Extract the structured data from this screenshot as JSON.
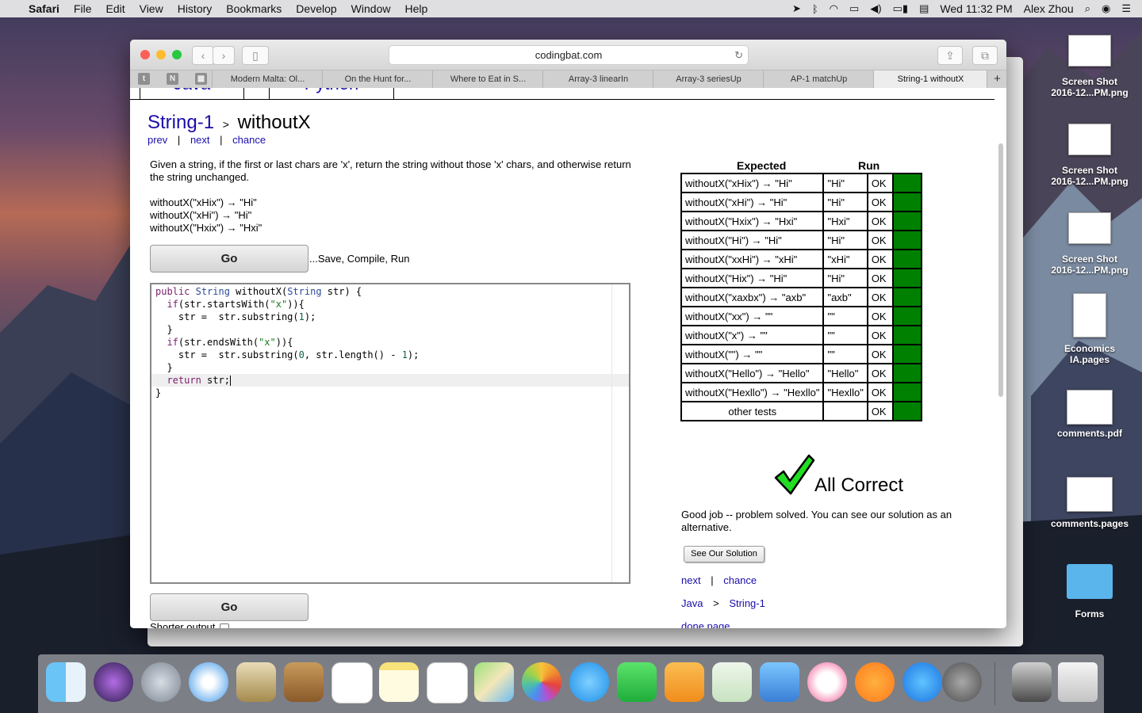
{
  "menubar": {
    "apple": "",
    "app": "Safari",
    "menus": [
      "File",
      "Edit",
      "View",
      "History",
      "Bookmarks",
      "Develop",
      "Window",
      "Help"
    ],
    "clock": "Wed 11:32 PM",
    "user": "Alex Zhou"
  },
  "desktop": {
    "icons": [
      {
        "label1": "Screen Shot",
        "label2": "2016-12...PM.png"
      },
      {
        "label1": "Screen Shot",
        "label2": "2016-12...PM.png"
      },
      {
        "label1": "Screen Shot",
        "label2": "2016-12...PM.png"
      },
      {
        "label1": "Economics",
        "label2": "IA.pages"
      },
      {
        "label1": "comments.pdf",
        "label2": ""
      },
      {
        "label1": "comments.pages",
        "label2": ""
      },
      {
        "label1": "Forms",
        "label2": ""
      }
    ]
  },
  "browser": {
    "url": "codingbat.com",
    "pinned": [
      "t",
      "N",
      "▦"
    ],
    "tabs": [
      "Modern Malta: Ol...",
      "On the Hunt for...",
      "Where to Eat in S...",
      "Array-3 linearIn",
      "Array-3 seriesUp",
      "AP-1 matchUp",
      "String-1 withoutX"
    ],
    "new_tab": "+"
  },
  "page": {
    "lang_tabs": [
      "Java",
      "Python"
    ],
    "crumb_section": "String-1",
    "crumb_sep": ">",
    "crumb_problem": "withoutX",
    "nav": {
      "prev": "prev",
      "next": "next",
      "chance": "chance",
      "bar": "|"
    },
    "description": "Given a string, if the first or last chars are 'x', return the string without those 'x' chars, and otherwise return the string unchanged.",
    "examples": [
      "withoutX(\"xHix\") → \"Hi\"",
      "withoutX(\"xHi\") → \"Hi\"",
      "withoutX(\"Hxix\") → \"Hxi\""
    ],
    "go_label": "Go",
    "go_hint": "...Save, Compile, Run",
    "shorter_output": "Shorter output",
    "results": {
      "headers": {
        "expected": "Expected",
        "run": "Run"
      },
      "rows": [
        {
          "expected": "withoutX(\"xHix\") → \"Hi\"",
          "run": "\"Hi\"",
          "status": "OK"
        },
        {
          "expected": "withoutX(\"xHi\") → \"Hi\"",
          "run": "\"Hi\"",
          "status": "OK"
        },
        {
          "expected": "withoutX(\"Hxix\") → \"Hxi\"",
          "run": "\"Hxi\"",
          "status": "OK"
        },
        {
          "expected": "withoutX(\"Hi\") → \"Hi\"",
          "run": "\"Hi\"",
          "status": "OK"
        },
        {
          "expected": "withoutX(\"xxHi\") → \"xHi\"",
          "run": "\"xHi\"",
          "status": "OK"
        },
        {
          "expected": "withoutX(\"Hix\") → \"Hi\"",
          "run": "\"Hi\"",
          "status": "OK"
        },
        {
          "expected": "withoutX(\"xaxbx\") → \"axb\"",
          "run": "\"axb\"",
          "status": "OK"
        },
        {
          "expected": "withoutX(\"xx\") → \"\"",
          "run": "\"\"",
          "status": "OK"
        },
        {
          "expected": "withoutX(\"x\") → \"\"",
          "run": "\"\"",
          "status": "OK"
        },
        {
          "expected": "withoutX(\"\") → \"\"",
          "run": "\"\"",
          "status": "OK"
        },
        {
          "expected": "withoutX(\"Hello\") → \"Hello\"",
          "run": "\"Hello\"",
          "status": "OK"
        },
        {
          "expected": "withoutX(\"Hexllo\") → \"Hexllo\"",
          "run": "\"Hexllo\"",
          "status": "OK"
        },
        {
          "expected": "other tests",
          "run": "",
          "status": "OK"
        }
      ],
      "pass_color": "#008000"
    },
    "all_correct": "All Correct",
    "good_job": "Good job -- problem solved. You can see our solution as an alternative.",
    "see_solution": "See Our Solution",
    "bottom_nav": {
      "next": "next",
      "chance": "chance",
      "java": "Java",
      "gt": ">",
      "section": "String-1",
      "done": "done page"
    }
  },
  "code": {
    "l1_kw": "public",
    "l1_ty": "String",
    "l1_a": " withoutX(",
    "l1_ty2": "String",
    "l1_b": " str) {",
    "l2_kw": "if",
    "l2_a": "(str.startsWith(",
    "l2_st": "\"x\"",
    "l2_b": ")){",
    "l3_a": "    str =  str.substring(",
    "l3_n": "1",
    "l3_b": ");",
    "l4": "  }",
    "l5_kw": "if",
    "l5_a": "(str.endsWith(",
    "l5_st": "\"x\"",
    "l5_b": ")){",
    "l6_a": "    str =  str.substring(",
    "l6_n": "0",
    "l6_b": ", str.length() - ",
    "l6_n2": "1",
    "l6_c": ");",
    "l7": "  }",
    "l8_kw": "return",
    "l8_a": " str;",
    "l9": "}"
  },
  "colors": {
    "link": "#1a0dab",
    "accent_green": "#008000",
    "keyword": "#7a1f6d"
  }
}
